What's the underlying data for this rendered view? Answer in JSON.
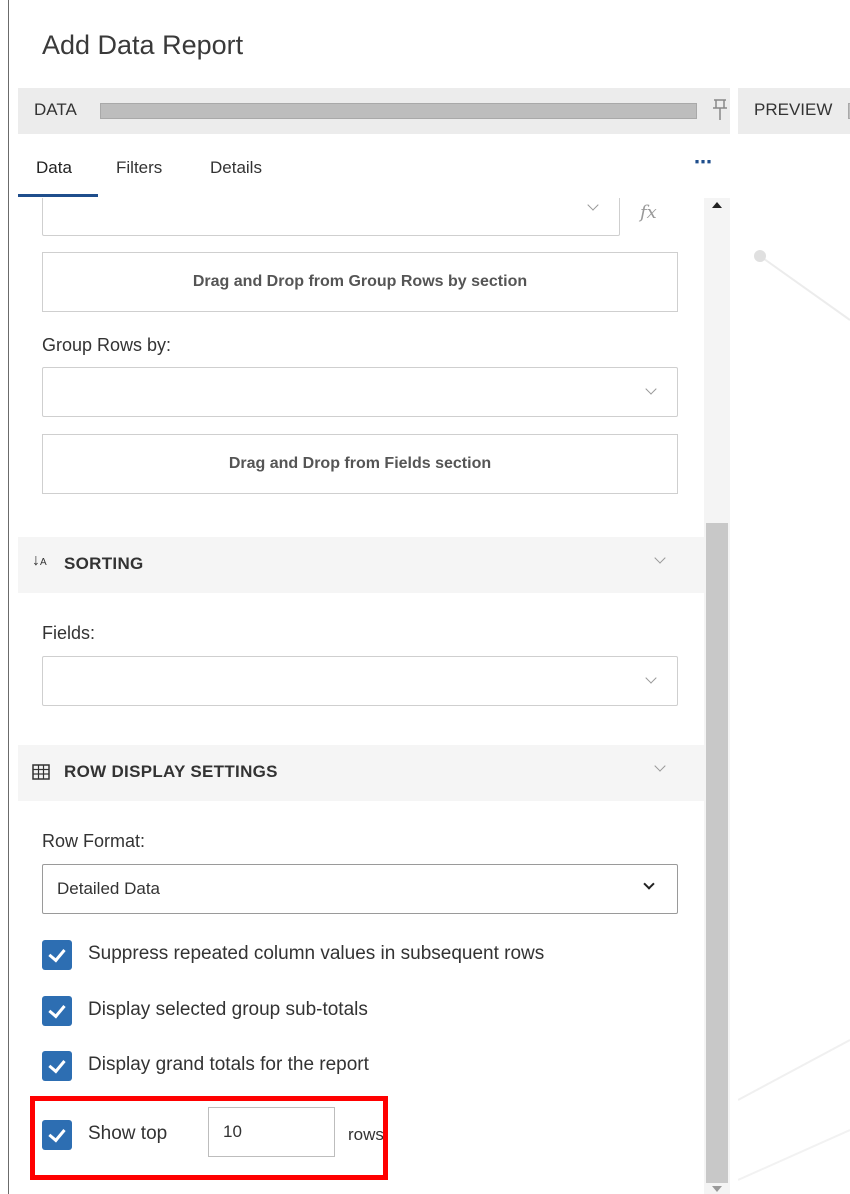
{
  "title": "Add Data Report",
  "data_panel": {
    "label": "DATA"
  },
  "preview_panel": {
    "label": "PREVIEW"
  },
  "tabs": [
    {
      "label": "Data"
    },
    {
      "label": "Filters"
    },
    {
      "label": "Details"
    }
  ],
  "more_label": "⋯",
  "fx_label": "fx",
  "dropzones": {
    "group_rows": "Drag and Drop from Group Rows by section",
    "fields": "Drag and Drop from Fields section"
  },
  "group_rows_label": "Group Rows by:",
  "sorting": {
    "title": "SORTING",
    "fields_label": "Fields:"
  },
  "row_display": {
    "title": "ROW DISPLAY SETTINGS",
    "row_format_label": "Row Format:",
    "row_format_value": "Detailed Data",
    "checks": [
      {
        "label": "Suppress repeated column values in subsequent rows",
        "checked": true
      },
      {
        "label": "Display selected group sub-totals",
        "checked": true
      },
      {
        "label": "Display grand totals for the report",
        "checked": true
      }
    ],
    "show_top": {
      "label": "Show top",
      "value": "10",
      "suffix": "rows",
      "checked": true
    }
  },
  "colors": {
    "accent": "#2d6eb2",
    "tab_underline": "#1f4e8c",
    "highlight": "#ff0000"
  }
}
